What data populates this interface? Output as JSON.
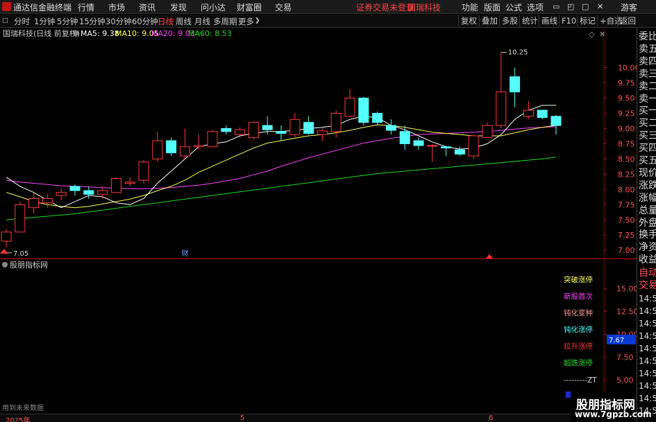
{
  "app": {
    "title": "通达信金融终端",
    "login_notice": "证券交易未登录",
    "stock_name": "国瑞科技",
    "user": "游客"
  },
  "menu": [
    "行情",
    "市场",
    "资讯",
    "发现",
    "问小达",
    "财富圈",
    "交易"
  ],
  "menu_right": [
    "功能",
    "版面",
    "公式",
    "选项"
  ],
  "timeframes": [
    "分时",
    "1分钟",
    "5分钟",
    "15分钟",
    "30分钟",
    "60分钟",
    "日线",
    "周线",
    "月线",
    "多周期",
    "更多"
  ],
  "toolbar_right": [
    "复权",
    "叠加",
    "多股",
    "统计",
    "画线",
    "F10",
    "标记",
    "+自选",
    "返回"
  ],
  "ma_legend": {
    "title": "国瑞科技(日线 前复权)",
    "ma5": "MA5: 9.38",
    "ma10": "MA10: 9.05",
    "ma20": "MA20: 9.03",
    "ma60": "MA60: 8.53"
  },
  "colors": {
    "up": "#ff3b3b",
    "down": "#54ffff",
    "ma5": "#ffffff",
    "ma10": "#ffff55",
    "ma20": "#ff44ff",
    "ma60": "#22dd22",
    "grid": "#8b0000"
  },
  "indicator": {
    "title": "股朋指标网",
    "labels": [
      "突破涨停",
      "新股首次",
      "钝化变种",
      "钝化涨停",
      "拉升涨停",
      "超跌涨停",
      "---------ZT"
    ],
    "current_value": "7.67"
  },
  "right_panel": {
    "items": [
      "委比",
      "卖五",
      "卖四",
      "卖三",
      "卖二",
      "卖一",
      "买一",
      "买二",
      "买三",
      "买四",
      "买五",
      "现价",
      "涨跌",
      "涨幅",
      "总量",
      "外盘",
      "换手",
      "净资",
      "收益"
    ],
    "lower": [
      "自动",
      "交易"
    ],
    "times": [
      "14:56",
      "14:56",
      "14:56",
      "14:56",
      "14:56",
      "14:56",
      "14:56",
      "14:56",
      "14:56",
      "14:56"
    ]
  },
  "footer": {
    "left_text": "用到未来数据",
    "date_labels": [
      "2025年",
      "5",
      "6"
    ],
    "watermark_title": "股朋指标网",
    "watermark_url": "www.7gpzb.com"
  },
  "chart_data": [
    {
      "type": "candlestick",
      "yticks": [
        7.0,
        7.25,
        7.5,
        7.75,
        8.0,
        8.25,
        8.5,
        8.75,
        9.0,
        9.25,
        9.5,
        9.75,
        10.0
      ],
      "ylim": [
        6.9,
        10.45
      ],
      "annotations": {
        "high": "10.25",
        "low": "7.05",
        "marker": "财"
      },
      "candles": [
        [
          7.15,
          7.3,
          7.05,
          7.35
        ],
        [
          7.3,
          7.75,
          7.3,
          7.8
        ],
        [
          7.7,
          7.85,
          7.6,
          7.95
        ],
        [
          7.78,
          7.85,
          7.7,
          7.92
        ],
        [
          7.9,
          7.95,
          7.82,
          8.02
        ],
        [
          8.05,
          7.98,
          7.9,
          8.08
        ],
        [
          7.98,
          7.92,
          7.85,
          8.05
        ],
        [
          7.92,
          7.98,
          7.85,
          8.05
        ],
        [
          7.95,
          8.18,
          7.95,
          8.2
        ],
        [
          8.1,
          8.12,
          8.05,
          8.2
        ],
        [
          8.15,
          8.45,
          8.1,
          8.48
        ],
        [
          8.5,
          8.8,
          8.45,
          8.95
        ],
        [
          8.8,
          8.6,
          8.55,
          8.85
        ],
        [
          8.55,
          8.7,
          8.5,
          9.0
        ],
        [
          8.7,
          8.72,
          8.65,
          8.9
        ],
        [
          8.7,
          8.95,
          8.7,
          8.98
        ],
        [
          9.0,
          8.95,
          8.9,
          9.05
        ],
        [
          8.9,
          8.98,
          8.85,
          9.02
        ],
        [
          8.85,
          9.1,
          8.82,
          9.12
        ],
        [
          9.05,
          8.98,
          8.9,
          9.2
        ],
        [
          8.95,
          8.92,
          8.8,
          9.05
        ],
        [
          8.9,
          9.15,
          8.85,
          9.25
        ],
        [
          9.1,
          8.92,
          8.9,
          9.2
        ],
        [
          8.9,
          8.96,
          8.8,
          9.0
        ],
        [
          8.95,
          9.25,
          8.85,
          9.3
        ],
        [
          9.2,
          9.5,
          9.2,
          9.65
        ],
        [
          9.5,
          9.1,
          9.05,
          9.52
        ],
        [
          9.25,
          9.1,
          9.05,
          9.28
        ],
        [
          9.05,
          8.97,
          8.9,
          9.15
        ],
        [
          8.95,
          8.75,
          8.65,
          9.05
        ],
        [
          8.8,
          8.72,
          8.65,
          8.85
        ],
        [
          8.72,
          8.72,
          8.45,
          8.75
        ],
        [
          8.7,
          8.68,
          8.55,
          8.72
        ],
        [
          8.65,
          8.58,
          8.55,
          8.7
        ],
        [
          8.55,
          8.88,
          8.5,
          8.9
        ],
        [
          8.85,
          9.05,
          8.85,
          9.1
        ],
        [
          9.05,
          9.6,
          9.0,
          10.25
        ],
        [
          9.85,
          9.6,
          9.35,
          10.0
        ],
        [
          9.2,
          9.3,
          9.15,
          9.45
        ],
        [
          9.3,
          9.18,
          9.15,
          9.3
        ],
        [
          9.2,
          9.05,
          8.9,
          9.22
        ]
      ],
      "ma5": [
        8.2,
        8.05,
        7.95,
        7.82,
        7.7,
        7.8,
        7.9,
        7.88,
        7.78,
        7.75,
        7.85,
        8.1,
        8.3,
        8.5,
        8.7,
        8.75,
        8.78,
        8.88,
        8.92,
        8.95,
        8.95,
        8.97,
        9.0,
        9.02,
        9.05,
        9.15,
        9.2,
        9.18,
        9.05,
        8.98,
        8.88,
        8.78,
        8.7,
        8.66,
        8.68,
        8.75,
        8.9,
        9.15,
        9.3,
        9.38,
        9.38
      ],
      "ma10": [
        7.95,
        7.88,
        7.8,
        7.75,
        7.72,
        7.7,
        7.72,
        7.76,
        7.8,
        7.84,
        7.9,
        7.98,
        8.05,
        8.15,
        8.28,
        8.38,
        8.48,
        8.58,
        8.68,
        8.76,
        8.8,
        8.84,
        8.88,
        8.9,
        8.93,
        8.97,
        9.02,
        9.06,
        9.05,
        9.02,
        8.98,
        8.94,
        8.92,
        8.9,
        8.88,
        8.88,
        8.88,
        8.93,
        8.98,
        9.02,
        9.05
      ],
      "ma20": [
        8.15,
        8.12,
        8.1,
        8.08,
        8.06,
        8.05,
        8.04,
        8.03,
        8.02,
        8.01,
        8.01,
        8.02,
        8.03,
        8.05,
        8.07,
        8.1,
        8.14,
        8.18,
        8.24,
        8.3,
        8.38,
        8.45,
        8.52,
        8.58,
        8.64,
        8.7,
        8.76,
        8.8,
        8.84,
        8.87,
        8.9,
        8.91,
        8.92,
        8.93,
        8.94,
        8.95,
        8.97,
        8.99,
        9.01,
        9.02,
        9.03
      ],
      "ma60": [
        7.5,
        7.52,
        7.54,
        7.56,
        7.58,
        7.6,
        7.63,
        7.66,
        7.69,
        7.72,
        7.75,
        7.78,
        7.81,
        7.84,
        7.87,
        7.9,
        7.93,
        7.96,
        7.99,
        8.02,
        8.05,
        8.08,
        8.11,
        8.14,
        8.17,
        8.2,
        8.23,
        8.26,
        8.28,
        8.3,
        8.32,
        8.34,
        8.36,
        8.38,
        8.4,
        8.42,
        8.44,
        8.46,
        8.48,
        8.5,
        8.53
      ]
    },
    {
      "type": "indicator",
      "title": "股朋指标网",
      "yticks": [
        5.0,
        7.5,
        10.0,
        12.5,
        15.0
      ],
      "ylim": [
        2.6,
        17.4
      ]
    }
  ]
}
